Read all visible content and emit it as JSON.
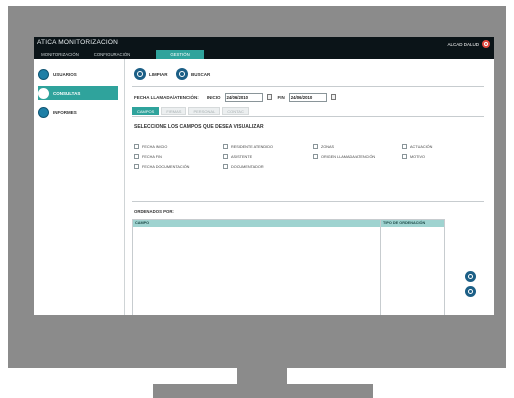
{
  "app": {
    "title": "ATICA MONITORIZACION",
    "user": "ALCAD DALUD"
  },
  "top_tabs": [
    "MONITORIZACIÓN",
    "CONFIGURACIÓN",
    "GESTIÓN"
  ],
  "sidebar": {
    "items": [
      {
        "label": "USUARIOS"
      },
      {
        "label": "CONSULTAS"
      },
      {
        "label": "INFORMES"
      }
    ]
  },
  "toolbar": {
    "limpiar": "LIMPIAR",
    "buscar": "BUSCAR"
  },
  "filters": {
    "label": "FECHA LLAMADA/ATENCIÓN:",
    "inicio_label": "INICIO",
    "inicio_value": "24/06/2010",
    "fin_label": "FIN",
    "fin_value": "24/06/2010"
  },
  "subtabs": [
    "CAMPOS",
    "FIRMAS",
    "PERSONAL",
    "CONTAC"
  ],
  "section": {
    "title": "SELECCIONE LOS CAMPOS QUE DESEA VISUALIZAR"
  },
  "fields": [
    "FECHA INICIO",
    "RESIDENTE ATENDIDO",
    "ZONAS",
    "ACTUACIÓN",
    "FECHA FIN",
    "ASISTENTE",
    "ORIGEN LLAMADA/ATENCIÓN",
    "MOTIVO",
    "FECHA DOCUMENTACIÓN",
    "DOCUMENTADOR"
  ],
  "ordering": {
    "label": "ORDENADOS POR:",
    "col_campo": "CAMPO",
    "col_tipo": "TIPO DE ORDENACIÓN"
  }
}
